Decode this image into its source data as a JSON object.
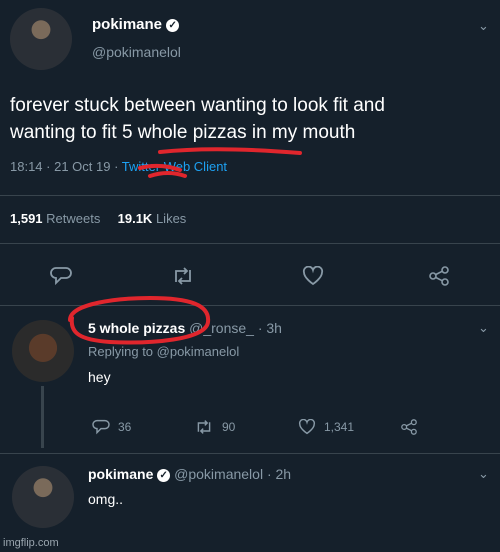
{
  "main_tweet": {
    "display_name": "pokimane",
    "handle": "@pokimanelol",
    "text_line1": "forever stuck between wanting to look fit and",
    "text_line2": "wanting to fit 5 whole pizzas in my mouth",
    "timestamp": "18:14 · 21 Oct 19 ·",
    "client": "Twitter Web Client",
    "retweets_count": "1,591",
    "retweets_label": "Retweets",
    "likes_count": "19.1K",
    "likes_label": "Likes"
  },
  "reply1": {
    "display_name": "5 whole pizzas",
    "handle": "@_ronse_",
    "time": "· 3h",
    "replying_to": "Replying to @pokimanelol",
    "text": "hey",
    "reply_count": "36",
    "retweet_count": "90",
    "like_count": "1,341"
  },
  "reply2": {
    "display_name": "pokimane",
    "handle": "@pokimanelol",
    "time": "· 2h",
    "text": "omg.."
  },
  "watermark": "imgflip.com",
  "colors": {
    "background": "#15202b",
    "muted": "#8899a6",
    "accent": "#1da1f2",
    "annotation": "#e0262d"
  }
}
